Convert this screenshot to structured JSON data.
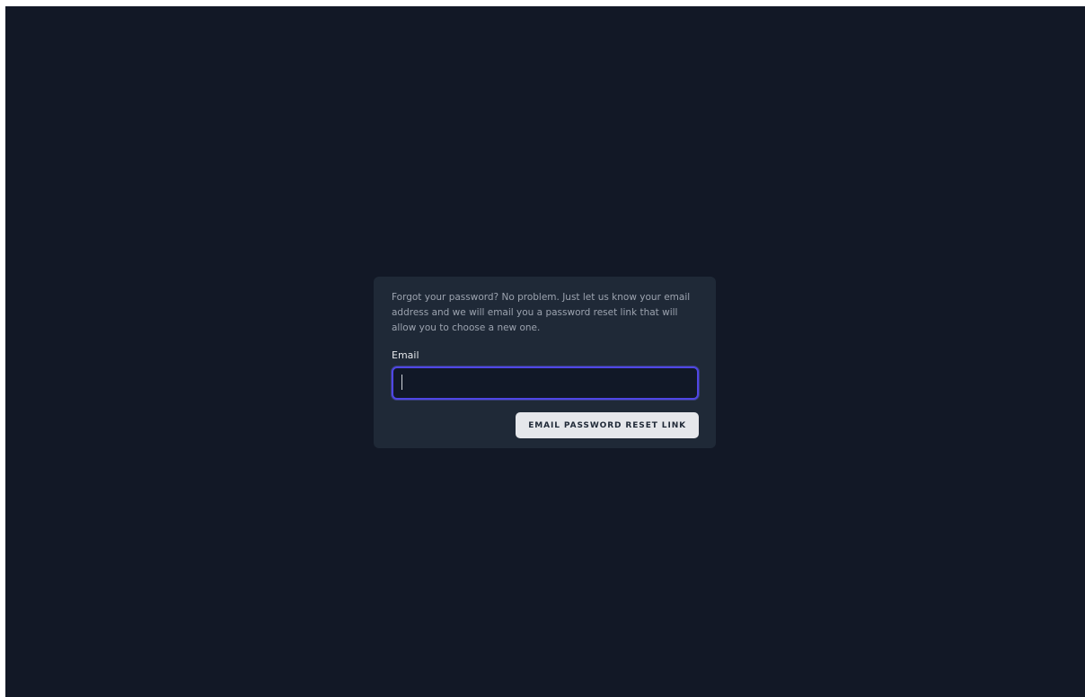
{
  "forgot_password": {
    "message": "Forgot your password? No problem. Just let us know your email address and we will email you a password reset link that will allow you to choose a new one.",
    "email_label": "Email",
    "email_value": "",
    "submit_label": "EMAIL PASSWORD RESET LINK"
  },
  "colors": {
    "page_background": "#121826",
    "card_background": "#1f2937",
    "input_focus_border": "#4f46e5",
    "button_background": "#e5e7eb"
  }
}
